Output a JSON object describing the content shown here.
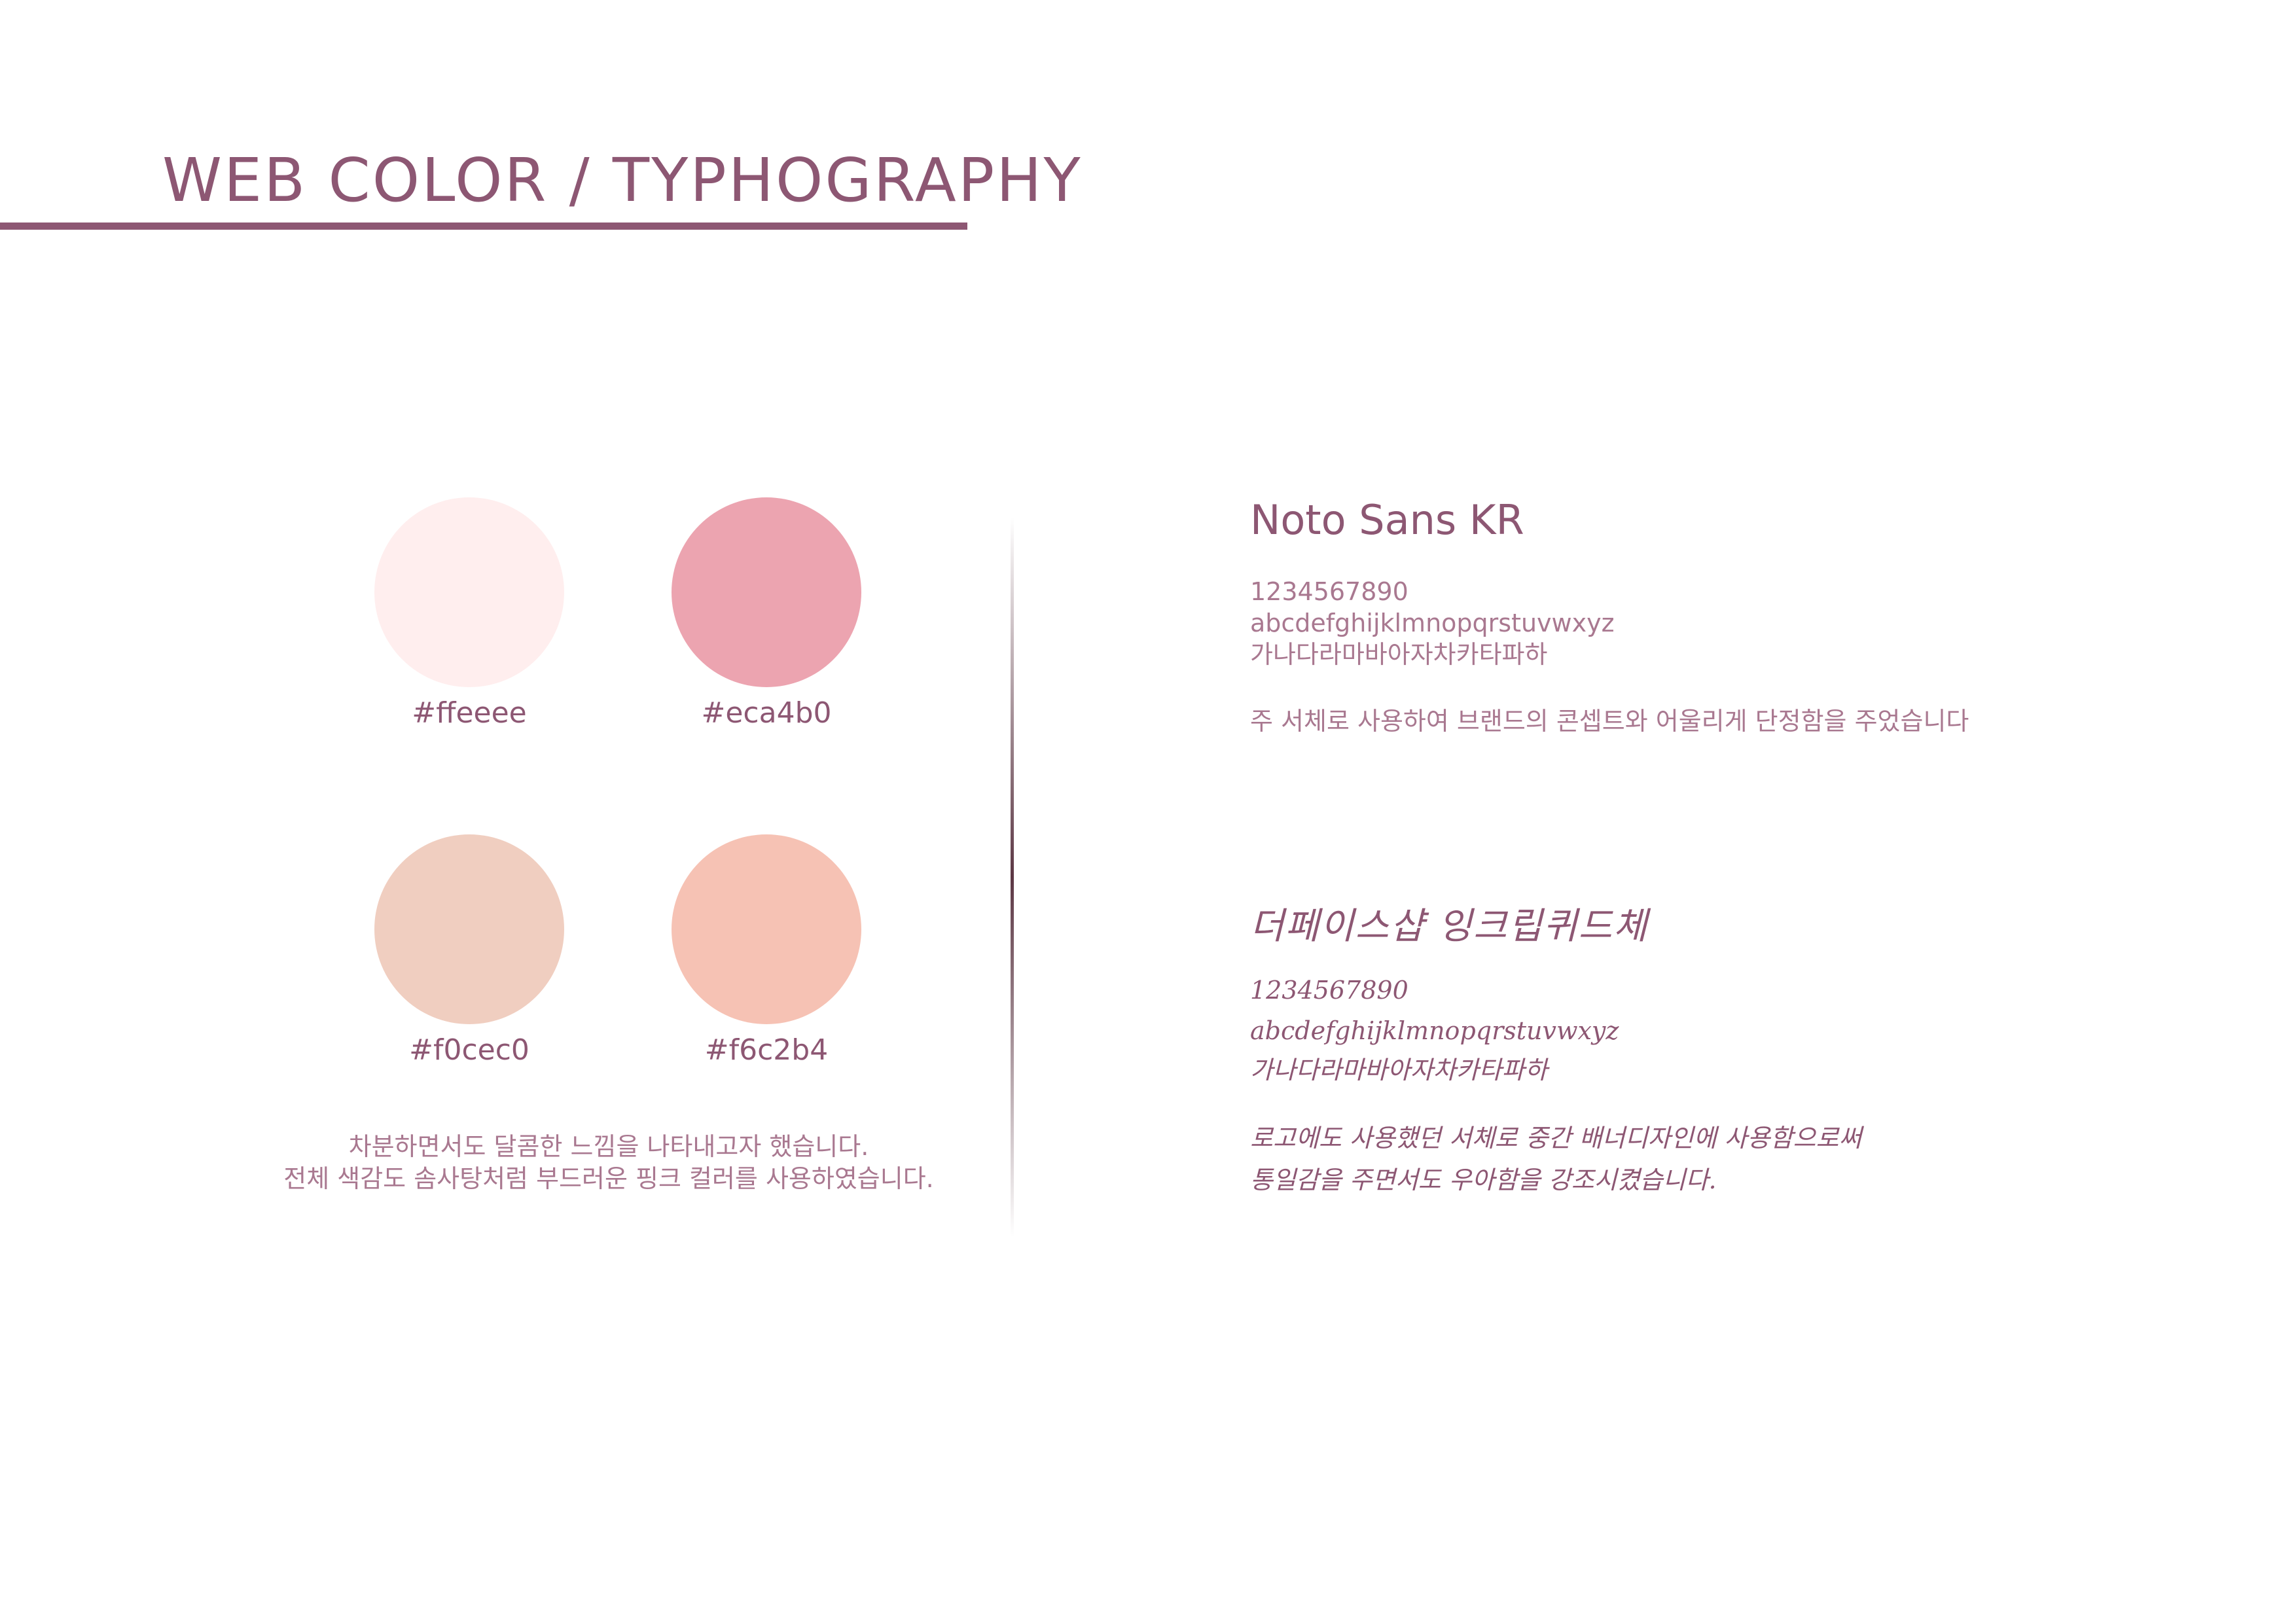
{
  "header": {
    "title": "WEB COLOR / TYPHOGRAPHY"
  },
  "palette": {
    "swatches": [
      {
        "hex_label": "#ffeeee",
        "color": "#ffeeee"
      },
      {
        "hex_label": "#eca4b0",
        "color": "#eca4b0"
      },
      {
        "hex_label": "#f0cec0",
        "color": "#f0cec0"
      },
      {
        "hex_label": "#f6c2b4",
        "color": "#f6c2b4"
      }
    ],
    "description": [
      "차분하면서도 달콤한 느낌을 나타내고자 했습니다.",
      "전체 색감도 솜사탕처럼 부드러운 핑크 컬러를 사용하였습니다."
    ]
  },
  "typography": {
    "fonts": [
      {
        "name": "Noto Sans KR",
        "numbers": "1234567890",
        "latin": "abcdefghijklmnopqrstuvwxyz",
        "hangul": "가나다라마바아자차카타파하",
        "description": [
          "주 서체로 사용하여 브랜드의 콘셉트와 어울리게 단정함을 주었습니다"
        ]
      },
      {
        "name": "더페이스샵 잉크립퀴드체",
        "numbers": "1234567890",
        "latin": "abcdefghijklmnopqrstuvwxyz",
        "hangul": "가나다라마바아자차카타파하",
        "description": [
          "로고에도 사용했던 서체로 중간 배너디자인에 사용함으로써",
          "통일감을 주면서도 우아함을 강조시켰습니다."
        ]
      }
    ]
  },
  "colors": {
    "accent": "#8d5773",
    "text_light": "#a97890"
  }
}
